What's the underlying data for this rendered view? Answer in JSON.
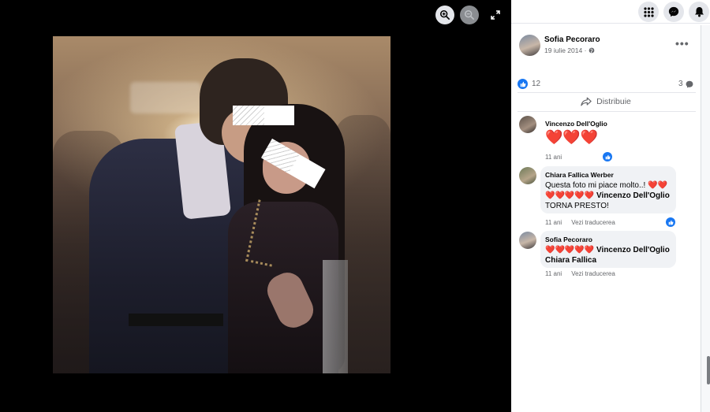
{
  "post": {
    "author": "Sofia Pecoraro",
    "date": "19 iulie 2014 ·",
    "privacy_icon": "globe-icon",
    "more": "•••",
    "likes": "12",
    "comments_count": "3",
    "share_label": "Distribuie"
  },
  "viewer": {
    "zoom_in_icon": "zoom-in-icon",
    "zoom_out_icon": "zoom-out-icon",
    "fullscreen_icon": "fullscreen-icon"
  },
  "topbar": {
    "menu_icon": "grid-menu-icon",
    "messenger_icon": "messenger-icon",
    "notifications_icon": "bell-icon"
  },
  "comments": [
    {
      "author": "Vincenzo Dell'Oglio",
      "hearts": "❤️❤️❤️",
      "time": "11 ani"
    },
    {
      "author": "Chiara Fallica Werber",
      "text1": "Questa foto mi piace molto..! ",
      "hearts1": "❤️❤️",
      "hearts2": "❤️❤️❤️❤️❤️",
      "mention": "Vincenzo Dell'Oglio",
      "text2": "TORNA PRESTO!",
      "time": "11 ani",
      "translate": "Vezi traducerea"
    },
    {
      "author": "Sofia Pecoraro",
      "hearts": "❤️❤️❤️❤️❤️",
      "mention1": "Vincenzo Dell'Oglio",
      "mention2": "Chiara Fallica",
      "time": "11 ani",
      "translate": "Vezi traducerea"
    }
  ],
  "colors": {
    "brand_blue": "#1877f2",
    "heart_red": "#e0245e",
    "text_secondary": "#65676b"
  }
}
